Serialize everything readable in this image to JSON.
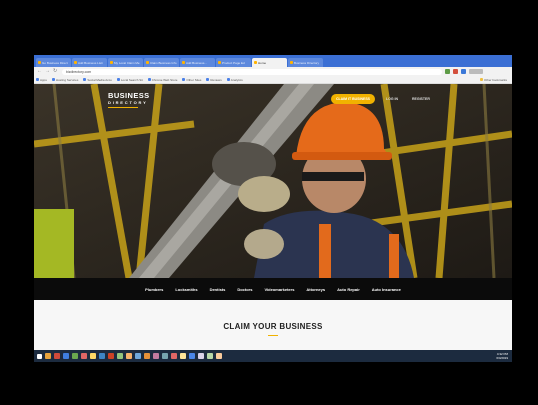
{
  "browser": {
    "tabs": [
      {
        "label": "Go Business Direct",
        "active": false
      },
      {
        "label": "Add Business Listi",
        "active": false
      },
      {
        "label": "My Local Claim Me",
        "active": false
      },
      {
        "label": "Claim Business Info",
        "active": false
      },
      {
        "label": "Add Business...",
        "active": false
      },
      {
        "label": "Product Page Ed",
        "active": false
      },
      {
        "label": "Home",
        "active": true
      },
      {
        "label": "Business Directory",
        "active": false
      }
    ],
    "url": "bizdirectory.com",
    "bookmarks": [
      "Apps",
      "Hosting Services",
      "Social Media Acco",
      "Local Search Sit",
      "Chrome Web Store",
      "Other Sites",
      "Reviews",
      "Analytics",
      "Other bookmarks"
    ]
  },
  "site": {
    "logo_line1": "BUSINESS",
    "logo_line2": "DIRECTORY",
    "claim_button": "CLAIM IT BUSINESS",
    "login_link": "LOG IN",
    "register_link": "REGISTER",
    "categories": [
      "Plumbers",
      "Locksmiths",
      "Dentists",
      "Doctors",
      "Videomarketers",
      "Attorneys",
      "Auto Repair",
      "Auto Insurance"
    ],
    "claim_heading": "CLAIM YOUR BUSINESS"
  },
  "taskbar": {
    "time": "4:32 PM",
    "date": "6/4/2019"
  },
  "colors": {
    "accent": "#f1b200",
    "chrome_tab_strip": "#3b6fd4",
    "taskbar": "#1c2b3f"
  }
}
